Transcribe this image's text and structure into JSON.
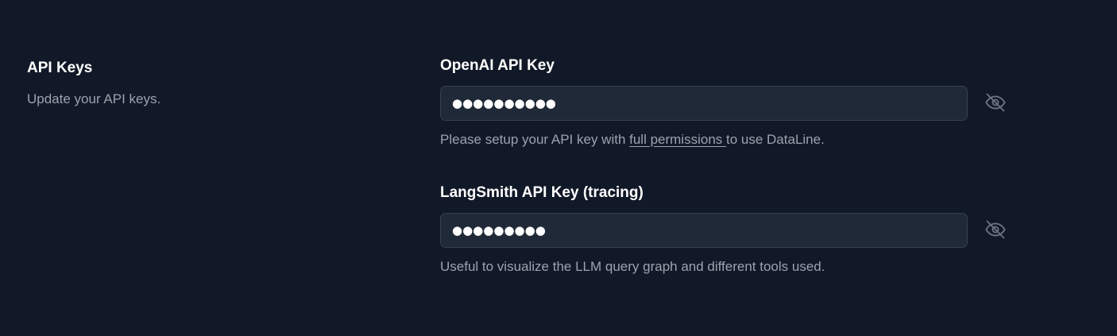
{
  "section": {
    "title": "API Keys",
    "description": "Update your API keys."
  },
  "openai": {
    "label": "OpenAI API Key",
    "value": "●●●●●●●●●●",
    "help_prefix": "Please setup your API key with ",
    "help_link": "full permissions ",
    "help_suffix": "to use DataLine.",
    "toggle_icon": "eye-off-icon"
  },
  "langsmith": {
    "label": "LangSmith API Key (tracing)",
    "value": "●●●●●●●●●",
    "help": "Useful to visualize the LLM query graph and different tools used.",
    "toggle_icon": "eye-off-icon"
  },
  "colors": {
    "background": "#111827",
    "input_bg": "#1f2937",
    "input_border": "#374151",
    "muted_text": "#9ca3af",
    "icon": "#6b7280"
  }
}
